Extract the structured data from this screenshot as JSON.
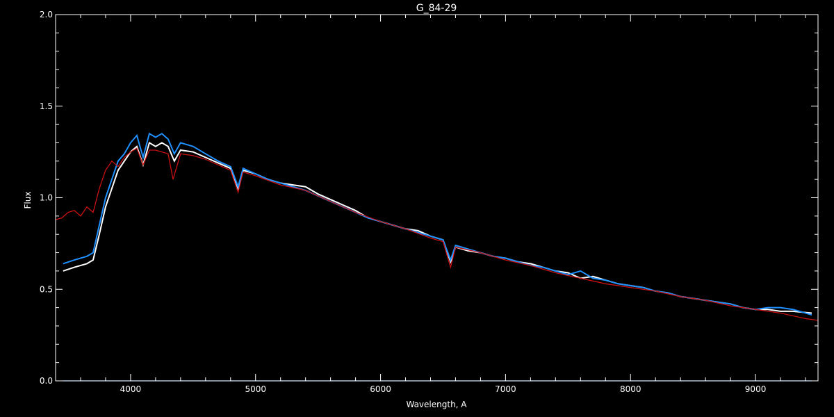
{
  "chart_data": {
    "type": "line",
    "title": "G_84-29",
    "xlabel": "Wavelength, A",
    "ylabel": "Flux",
    "xlim": [
      3400,
      9500
    ],
    "ylim": [
      0.0,
      2.0
    ],
    "x_ticks": [
      4000,
      5000,
      6000,
      7000,
      8000,
      9000
    ],
    "x_tick_labels": [
      "4000",
      "5000",
      "6000",
      "7000",
      "8000",
      "9000"
    ],
    "y_ticks": [
      0.0,
      0.5,
      1.0,
      1.5,
      2.0
    ],
    "y_tick_labels": [
      "0.0",
      "0.5",
      "1.0",
      "1.5",
      "2.0"
    ],
    "grid": false,
    "colors": {
      "background": "#000000",
      "axes": "#ffffff",
      "observed": "#ffffff",
      "overlay": "#1e90ff",
      "model": "#cc1111"
    },
    "series": [
      {
        "color": "#ffffff",
        "x": [
          3460,
          3550,
          3650,
          3700,
          3750,
          3800,
          3850,
          3900,
          3950,
          4000,
          4050,
          4100,
          4150,
          4200,
          4250,
          4300,
          4350,
          4400,
          4500,
          4600,
          4700,
          4800,
          4860,
          4900,
          5000,
          5100,
          5200,
          5300,
          5400,
          5500,
          5600,
          5700,
          5800,
          5900,
          6000,
          6100,
          6200,
          6300,
          6400,
          6500,
          6560,
          6600,
          6700,
          6800,
          6900,
          7000,
          7100,
          7200,
          7300,
          7400,
          7500,
          7600,
          7700,
          7800,
          7900,
          8000,
          8100,
          8200,
          8300,
          8400,
          8500,
          8600,
          8700,
          8800,
          8900,
          9000,
          9100,
          9200,
          9300,
          9450
        ],
        "y": [
          0.6,
          0.62,
          0.64,
          0.66,
          0.8,
          0.95,
          1.05,
          1.15,
          1.2,
          1.25,
          1.28,
          1.18,
          1.3,
          1.28,
          1.3,
          1.28,
          1.2,
          1.26,
          1.25,
          1.22,
          1.19,
          1.16,
          1.05,
          1.15,
          1.13,
          1.1,
          1.08,
          1.07,
          1.06,
          1.02,
          0.99,
          0.96,
          0.93,
          0.89,
          0.87,
          0.85,
          0.83,
          0.82,
          0.79,
          0.77,
          0.65,
          0.73,
          0.71,
          0.7,
          0.68,
          0.67,
          0.65,
          0.64,
          0.62,
          0.6,
          0.59,
          0.56,
          0.57,
          0.55,
          0.53,
          0.52,
          0.51,
          0.49,
          0.48,
          0.46,
          0.45,
          0.44,
          0.43,
          0.42,
          0.4,
          0.39,
          0.39,
          0.38,
          0.38,
          0.37
        ]
      },
      {
        "color": "#1e90ff",
        "x": [
          3460,
          3550,
          3650,
          3700,
          3750,
          3800,
          3850,
          3900,
          3950,
          4000,
          4050,
          4100,
          4150,
          4200,
          4250,
          4300,
          4350,
          4400,
          4500,
          4600,
          4700,
          4800,
          4860,
          4900,
          5000,
          5100,
          5200,
          5300,
          5400,
          5500,
          5600,
          5700,
          5800,
          5900,
          6000,
          6100,
          6200,
          6300,
          6400,
          6500,
          6560,
          6600,
          6700,
          6800,
          6900,
          7000,
          7100,
          7200,
          7300,
          7400,
          7500,
          7600,
          7700,
          7800,
          7900,
          8000,
          8100,
          8200,
          8300,
          8400,
          8500,
          8600,
          8700,
          8800,
          8900,
          9000,
          9100,
          9200,
          9300,
          9450
        ],
        "y": [
          0.64,
          0.66,
          0.68,
          0.7,
          0.85,
          1.0,
          1.1,
          1.2,
          1.24,
          1.3,
          1.34,
          1.22,
          1.35,
          1.33,
          1.35,
          1.32,
          1.24,
          1.3,
          1.28,
          1.24,
          1.2,
          1.17,
          1.06,
          1.16,
          1.13,
          1.1,
          1.08,
          1.06,
          1.04,
          1.01,
          0.98,
          0.95,
          0.92,
          0.89,
          0.87,
          0.85,
          0.83,
          0.81,
          0.79,
          0.77,
          0.66,
          0.74,
          0.72,
          0.7,
          0.68,
          0.67,
          0.65,
          0.63,
          0.62,
          0.6,
          0.58,
          0.6,
          0.56,
          0.55,
          0.53,
          0.52,
          0.51,
          0.49,
          0.48,
          0.46,
          0.45,
          0.44,
          0.43,
          0.42,
          0.4,
          0.39,
          0.4,
          0.4,
          0.39,
          0.36
        ]
      },
      {
        "color": "#cc1111",
        "x": [
          3400,
          3450,
          3500,
          3550,
          3600,
          3650,
          3700,
          3750,
          3800,
          3850,
          3900,
          3950,
          4000,
          4050,
          4100,
          4150,
          4200,
          4250,
          4300,
          4340,
          4400,
          4500,
          4600,
          4700,
          4800,
          4860,
          4900,
          5000,
          5200,
          5400,
          5600,
          5800,
          6000,
          6200,
          6400,
          6500,
          6560,
          6600,
          6800,
          7000,
          7200,
          7400,
          7600,
          7800,
          8000,
          8200,
          8400,
          8600,
          8800,
          9000,
          9200,
          9400,
          9500
        ],
        "y": [
          0.88,
          0.89,
          0.92,
          0.93,
          0.9,
          0.95,
          0.92,
          1.05,
          1.15,
          1.2,
          1.17,
          1.22,
          1.25,
          1.27,
          1.18,
          1.26,
          1.26,
          1.25,
          1.24,
          1.1,
          1.24,
          1.23,
          1.21,
          1.18,
          1.15,
          1.03,
          1.14,
          1.12,
          1.07,
          1.04,
          0.98,
          0.92,
          0.87,
          0.83,
          0.78,
          0.76,
          0.62,
          0.73,
          0.7,
          0.66,
          0.63,
          0.59,
          0.56,
          0.53,
          0.51,
          0.49,
          0.46,
          0.44,
          0.41,
          0.39,
          0.37,
          0.34,
          0.33
        ]
      },
      {
        "color": "#1e90ff",
        "x": [
          3460,
          9450
        ],
        "y": [
          0.0,
          0.0
        ]
      }
    ]
  }
}
